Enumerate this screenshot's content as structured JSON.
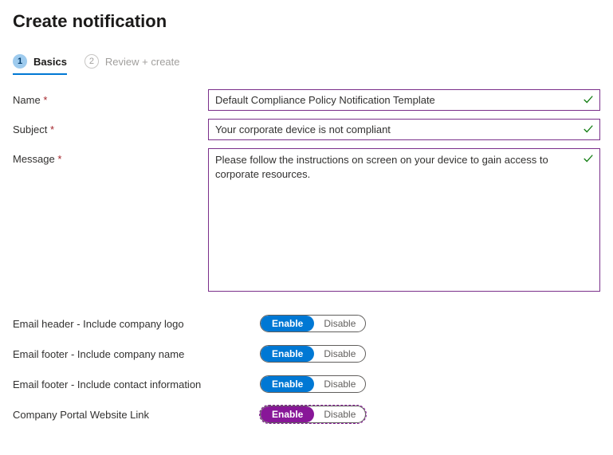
{
  "page": {
    "title": "Create notification"
  },
  "tabs": {
    "basics": {
      "num": "1",
      "label": "Basics"
    },
    "review": {
      "num": "2",
      "label": "Review + create"
    }
  },
  "form": {
    "name": {
      "label": "Name",
      "value": "Default Compliance Policy Notification Template"
    },
    "subject": {
      "label": "Subject",
      "value": "Your corporate device is not compliant"
    },
    "message": {
      "label": "Message",
      "value": "Please follow the instructions on screen on your device to gain access to corporate resources."
    }
  },
  "toggles": {
    "headerLogo": {
      "label": "Email header - Include company logo",
      "on": "Enable",
      "off": "Disable"
    },
    "footerName": {
      "label": "Email footer - Include company name",
      "on": "Enable",
      "off": "Disable"
    },
    "footerContact": {
      "label": "Email footer - Include contact information",
      "on": "Enable",
      "off": "Disable"
    },
    "portalLink": {
      "label": "Company Portal Website Link",
      "on": "Enable",
      "off": "Disable"
    }
  }
}
